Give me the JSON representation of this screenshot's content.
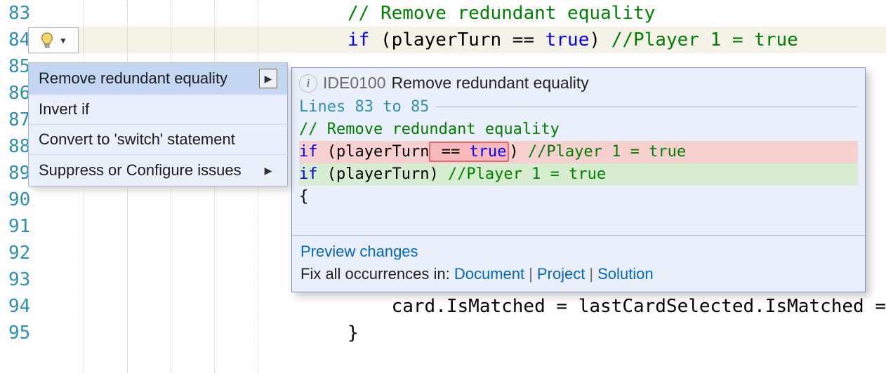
{
  "gutter": {
    "start": 83,
    "end": 95
  },
  "code": {
    "l83": {
      "comment": "// Remove redundant equality"
    },
    "l84": {
      "kw_if": "if",
      "paren_text": " (playerTurn == ",
      "kw_true": "true",
      "after": ") ",
      "comment": "//Player 1 = true"
    },
    "l94": {
      "text": "card.IsMatched = lastCardSelected.IsMatched ="
    },
    "l95": {
      "brace": "}"
    }
  },
  "menu": {
    "items": [
      {
        "label": "Remove redundant equality",
        "submenu": true,
        "selected": true
      },
      {
        "label": "Invert if",
        "submenu": false
      },
      {
        "label": "Convert to 'switch' statement",
        "submenu": false
      },
      {
        "label": "Suppress or Configure issues",
        "submenu": true
      }
    ]
  },
  "flyout": {
    "rule_id": "IDE0100",
    "rule_title": "Remove redundant equality",
    "lines_label": "Lines 83 to 85",
    "diff_comment": "// Remove redundant equality",
    "del": {
      "kw_if": "if",
      "pre": " (playerTurn",
      "box": " == true",
      "post": ") ",
      "comment": "//Player 1 = true"
    },
    "add": {
      "kw_if": "if",
      "body": " (playerTurn) ",
      "comment": "//Player 1 = true"
    },
    "brace": "{",
    "preview_label": "Preview changes",
    "fix_label": "Fix all occurrences in: ",
    "link_document": "Document",
    "link_project": "Project",
    "link_solution": "Solution"
  }
}
